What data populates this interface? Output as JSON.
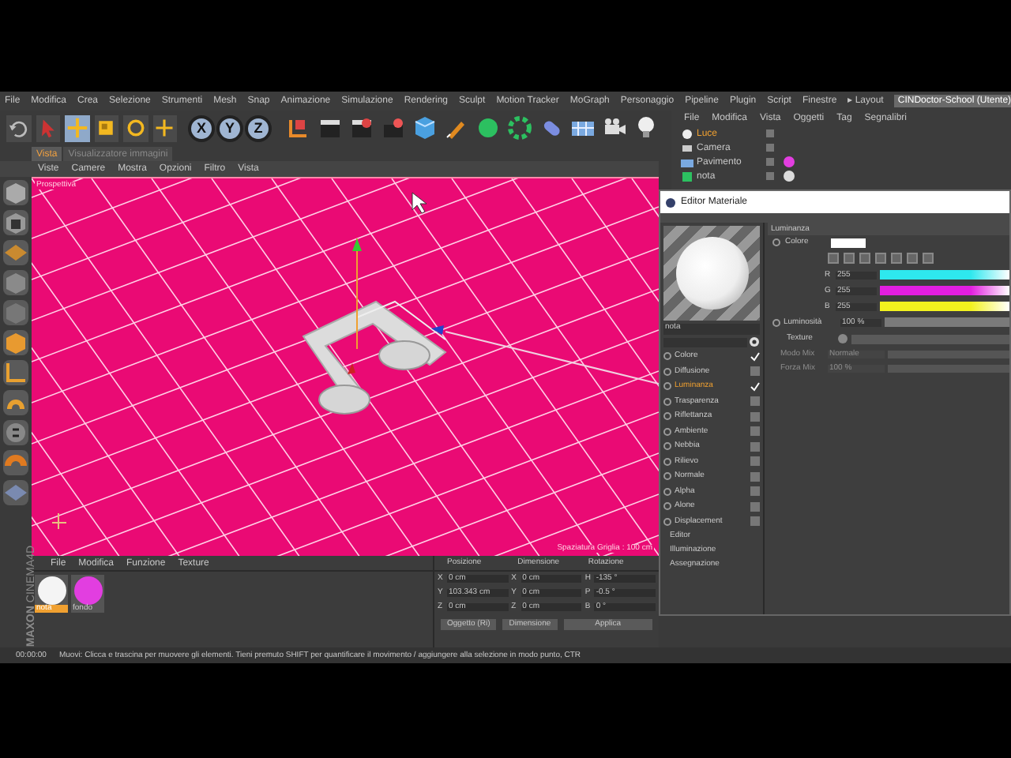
{
  "menu_bar": {
    "items": [
      "File",
      "Modifica",
      "Crea",
      "Selezione",
      "Strumenti",
      "Mesh",
      "Snap",
      "Animazione",
      "Simulazione",
      "Rendering",
      "Sculpt",
      "Motion Tracker",
      "MoGraph",
      "Personaggio",
      "Pipeline",
      "Plugin",
      "Script",
      "Finestre"
    ],
    "layout_label": "▸ Layout",
    "layout_value": "CINDoctor-School (Utente)"
  },
  "toolbar": {
    "tools": [
      {
        "kind": "undo",
        "selected": false
      },
      {
        "kind": "select",
        "selected": false
      },
      {
        "kind": "move",
        "selected": true
      },
      {
        "kind": "scale",
        "selected": false
      },
      {
        "kind": "rotate",
        "selected": false
      },
      {
        "kind": "add",
        "selected": false
      }
    ],
    "axes": [
      {
        "label": "X",
        "selected": true
      },
      {
        "label": "Y",
        "selected": true
      },
      {
        "label": "Z",
        "selected": true
      }
    ]
  },
  "view_tabs": [
    {
      "label": "Vista",
      "selected": true
    },
    {
      "label": "Visualizzatore immagini",
      "selected": false
    }
  ],
  "view_menu": [
    "Viste",
    "Camere",
    "Mostra",
    "Opzioni",
    "Filtro",
    "Vista"
  ],
  "viewport": {
    "camera_label": "Prospettiva",
    "grid_label": "Spaziatura Griglia : 100 cm"
  },
  "material_manager": {
    "menu": [
      "File",
      "Modifica",
      "Funzione",
      "Texture"
    ],
    "materials": [
      {
        "name": "nota",
        "selected": true,
        "color": "#f4f4f4"
      },
      {
        "name": "fondo",
        "selected": false,
        "color": "#e23ee0"
      }
    ]
  },
  "logo": {
    "brand": "MAXON",
    "product": "CINEMA4D"
  },
  "coordinates": {
    "headers": [
      "Posizione",
      "Dimensione",
      "Rotazione"
    ],
    "rows": [
      {
        "pos_axis": "X",
        "position": "0 cm",
        "size_axis": "X",
        "size": "0 cm",
        "rot_axis": "H",
        "rotation": "-135 °"
      },
      {
        "pos_axis": "Y",
        "position": "103.343 cm",
        "size_axis": "Y",
        "size": "0 cm",
        "rot_axis": "P",
        "rotation": "-0.5 °"
      },
      {
        "pos_axis": "Z",
        "position": "0 cm",
        "size_axis": "Z",
        "size": "0 cm",
        "rot_axis": "B",
        "rotation": "0 °"
      }
    ],
    "mode_dropdown": "Oggetto (Ri)",
    "size_dropdown": "Dimensione",
    "apply_button": "Applica"
  },
  "status_bar": {
    "time": "00:00:00",
    "message": "Muovi: Clicca e trascina per muovere gli elementi. Tieni premuto SHIFT per quantificare il movimento / aggiungere alla selezione in modo punto, CTR"
  },
  "object_manager": {
    "menu": [
      "File",
      "Modifica",
      "Vista",
      "Oggetti",
      "Tag",
      "Segnalibri"
    ],
    "objects": [
      {
        "name": "Luce",
        "kind": "light",
        "selected": true
      },
      {
        "name": "Camera",
        "kind": "camera",
        "selected": false
      },
      {
        "name": "Pavimento",
        "kind": "floor",
        "selected": false,
        "color": "#e23ee0"
      },
      {
        "name": "nota",
        "kind": "extrude",
        "selected": false,
        "color": "#dcdcdc"
      }
    ]
  },
  "material_editor": {
    "title": "Editor Materiale",
    "material_name": "nota",
    "channels": [
      {
        "label": "Colore",
        "checked": true,
        "selected": false
      },
      {
        "label": "Diffusione",
        "checked": false,
        "selected": false
      },
      {
        "label": "Luminanza",
        "checked": true,
        "selected": true
      },
      {
        "label": "Trasparenza",
        "checked": false,
        "selected": false
      },
      {
        "label": "Riflettanza",
        "checked": false,
        "selected": false
      },
      {
        "label": "Ambiente",
        "checked": false,
        "selected": false
      },
      {
        "label": "Nebbia",
        "checked": false,
        "selected": false
      },
      {
        "label": "Rilievo",
        "checked": false,
        "selected": false
      },
      {
        "label": "Normale",
        "checked": false,
        "selected": false
      },
      {
        "label": "Alpha",
        "checked": false,
        "selected": false
      },
      {
        "label": "Alone",
        "checked": false,
        "selected": false
      },
      {
        "label": "Displacement",
        "checked": false,
        "selected": false
      }
    ],
    "pages": [
      "Editor",
      "Illuminazione",
      "Assegnazione"
    ],
    "panel": {
      "title": "Luminanza",
      "color_label": "Colore",
      "rgb": [
        {
          "label": "R",
          "value": "255",
          "color": "#2ee8ee"
        },
        {
          "label": "G",
          "value": "255",
          "color": "#e21ee0"
        },
        {
          "label": "B",
          "value": "255",
          "color": "#f2f21e"
        }
      ],
      "brightness": {
        "label": "Luminosità",
        "value": "100 %",
        "level": 1
      },
      "texture_label": "Texture",
      "mix_mode": {
        "label": "Modo Mix",
        "value": "Normale",
        "disabled": true
      },
      "mix_strength": {
        "label": "Forza Mix",
        "value": "100 %",
        "disabled": true
      }
    }
  }
}
